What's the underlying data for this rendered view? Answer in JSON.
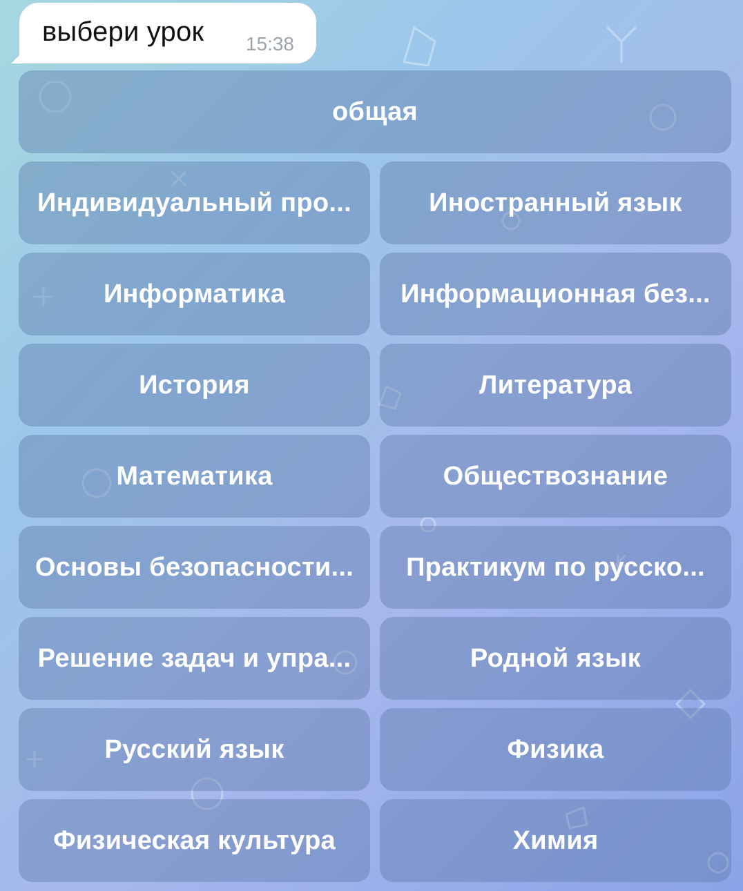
{
  "message": {
    "text": "выбери урок",
    "time": "15:38"
  },
  "keyboard": {
    "rows": [
      [
        "общая"
      ],
      [
        "Индивидуальный про...",
        "Иностранный язык"
      ],
      [
        "Информатика",
        "Информационная без..."
      ],
      [
        "История",
        "Литература"
      ],
      [
        "Математика",
        "Обществознание"
      ],
      [
        "Основы безопасности...",
        "Практикум по русско..."
      ],
      [
        "Решение задач и упра...",
        "Родной язык"
      ],
      [
        "Русский язык",
        "Физика"
      ],
      [
        "Физическая культура",
        "Химия"
      ]
    ]
  },
  "colors": {
    "button_bg": "#5c7aaa",
    "bubble_bg": "#ffffff",
    "time_text": "#9aa4ad"
  }
}
